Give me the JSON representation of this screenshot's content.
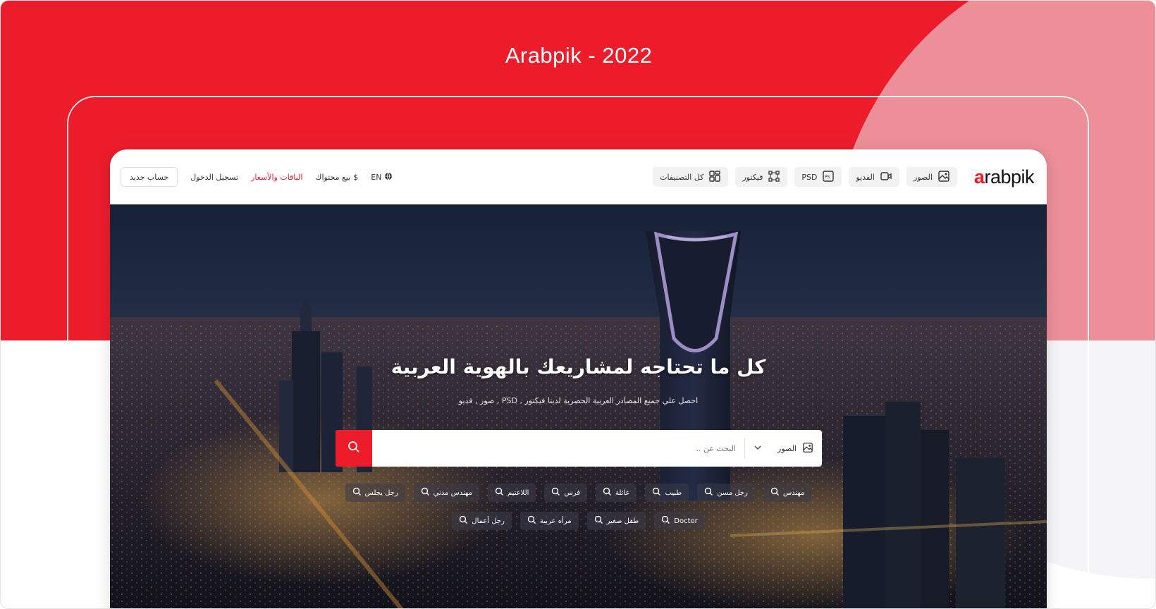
{
  "banner": {
    "title": "Arabpik - 2022"
  },
  "navbar": {
    "logo_text": "rabpik",
    "logo_mark": "a",
    "categories": [
      {
        "label": "الصور",
        "icon": "image-icon"
      },
      {
        "label": "الفديو",
        "icon": "video-icon"
      },
      {
        "label": "PSD",
        "icon": "psd-icon"
      },
      {
        "label": "فيكتور",
        "icon": "vector-icon"
      },
      {
        "label": "كل التصنيفات",
        "icon": "grid-icon"
      }
    ],
    "language": "EN",
    "sell_content": "بيع محتواك",
    "pricing": "الباقات والأسعار",
    "login": "تسجيل الدخول",
    "register": "حساب جديد"
  },
  "hero": {
    "title": "كل ما تحتاجه لمشاريعك بالهوية العربية",
    "subtitle": "احصل علي جميع المصادر العربية الحصرية لدينا فيكتور , PSD , صور , فديو"
  },
  "search": {
    "type_label": "الصور",
    "placeholder": "البحث عن .."
  },
  "tags": {
    "row1": [
      "مهندس",
      "رجل مسن",
      "طبيب",
      "عائلة",
      "فرس",
      "اللاعتيم",
      "مهندس مدني",
      "رجل يجلس"
    ],
    "row2": [
      "Doctor",
      "طفل صغير",
      "مرأه عربية",
      "رجل أعمال"
    ]
  },
  "colors": {
    "brand": "#ec1c2b",
    "background_white": "#ffffff"
  }
}
